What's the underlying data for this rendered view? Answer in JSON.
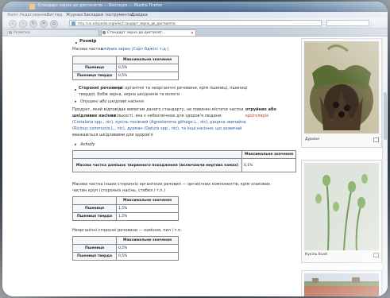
{
  "window": {
    "title": "Стандарт зерна до дистилятів — Вікіпедія — Mozilla Firefox"
  },
  "menu": {
    "items": [
      "Файл",
      "Редагування",
      "Вигляд",
      "Журнал",
      "Закладки",
      "Інструменти",
      "Довідка"
    ]
  },
  "nav": {
    "url": "http://uk.wikipedia.org/wiki/Стандарт_зерна_до_дистилятів",
    "back": "‹",
    "forward": "›",
    "reload": "↻",
    "stop": "✕",
    "home": "⌂"
  },
  "tabs": [
    {
      "label": "Розмітка",
      "active": false
    },
    {
      "label": "Стандарт зерна до дистилят...",
      "active": true
    }
  ],
  "article": {
    "section_rozmir": "Розмір",
    "mass_line_a": "Масова частка",
    "mass_line_link": "олійних зерен (Сорт бджіл: т.д.)",
    "table1": {
      "header": "Максимальне значення",
      "rows": [
        {
          "label": "Пшениця",
          "value": "0,5%"
        },
        {
          "label": "Пшениця тверда",
          "value": "0,5%"
        }
      ]
    },
    "foreign_bold": "Сторонні речовини",
    "foreign_rest": " — усі органічні та неорганічні речовини, крім пшениці, пшениці",
    "foreign_line2": "твердої, бобів зерна, зерна шкідників та вологи",
    "sub_spoiled": "Опущені або шкідливі насіння",
    "spoiled_line1_a": "Продукт, який відповідає вимогам даного стандарту, не повинен містити частки",
    "spoiled_line1_bold": "отруйних або",
    "spoiled_line2_bold": "шкідливих насіння",
    "spoiled_line2_rest": " в кількості, яка є небезпечною для здоров'я людини:",
    "spoiled_link_red": "кротолярія",
    "spoiled_line3": "(Crotalaria spp., ліс), кукіль посівний (Agrostemma githago L., ліс), рицина звичайна",
    "spoiled_line4": "(Ricinus communis L., ліс), дурман (Datura spp., ліс), та інші насіння, що зазвичай",
    "spoiled_line5": "вважаються шкідливими для здоров'я",
    "sub_animal": "Avfodly",
    "table2": {
      "header": "Максимальне значення",
      "row_label": "Масова частка домішок тваринного походження (включаючи мертвих комах)",
      "row_value": "0,1%"
    },
    "other_line1": "Масова частка інших сторонніх органічних речовин — органічних компонентів, крім злакових",
    "other_line2": "частин круп (сторонніх насінь, стебел і т.п.)",
    "table3": {
      "header": "Максимальне значення",
      "rows": [
        {
          "label": "Пшениця",
          "value": "1,5%"
        },
        {
          "label": "Пшениця тверда",
          "value": "1,5%"
        }
      ]
    },
    "inorganic_line": "Неорганічні сторонні речовини — каміння, пил і т.п.",
    "table4": {
      "header": "Максимальне значення",
      "rows": [
        {
          "label": "Пшениця",
          "value": "0,5%"
        },
        {
          "label": "Пшениця тверда",
          "value": "0,5%"
        }
      ]
    }
  },
  "images": [
    {
      "caption": "Дурман"
    },
    {
      "caption": "Кукіль бсий"
    }
  ],
  "colors": {
    "link": "#2c5aa0",
    "red_link": "#b8321e",
    "titlebar": "#3e5f85"
  }
}
